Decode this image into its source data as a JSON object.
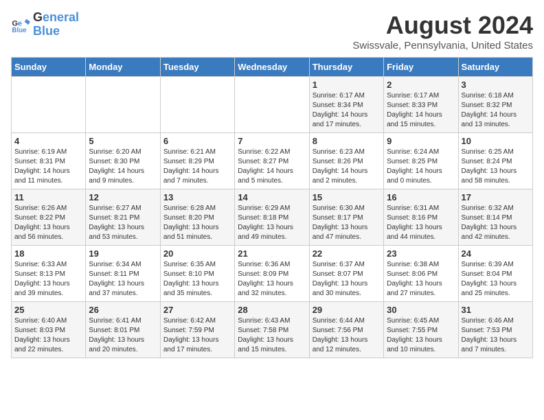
{
  "logo": {
    "line1": "General",
    "line2": "Blue"
  },
  "title": "August 2024",
  "location": "Swissvale, Pennsylvania, United States",
  "days_of_week": [
    "Sunday",
    "Monday",
    "Tuesday",
    "Wednesday",
    "Thursday",
    "Friday",
    "Saturday"
  ],
  "weeks": [
    [
      {
        "day": "",
        "info": ""
      },
      {
        "day": "",
        "info": ""
      },
      {
        "day": "",
        "info": ""
      },
      {
        "day": "",
        "info": ""
      },
      {
        "day": "1",
        "info": "Sunrise: 6:17 AM\nSunset: 8:34 PM\nDaylight: 14 hours\nand 17 minutes."
      },
      {
        "day": "2",
        "info": "Sunrise: 6:17 AM\nSunset: 8:33 PM\nDaylight: 14 hours\nand 15 minutes."
      },
      {
        "day": "3",
        "info": "Sunrise: 6:18 AM\nSunset: 8:32 PM\nDaylight: 14 hours\nand 13 minutes."
      }
    ],
    [
      {
        "day": "4",
        "info": "Sunrise: 6:19 AM\nSunset: 8:31 PM\nDaylight: 14 hours\nand 11 minutes."
      },
      {
        "day": "5",
        "info": "Sunrise: 6:20 AM\nSunset: 8:30 PM\nDaylight: 14 hours\nand 9 minutes."
      },
      {
        "day": "6",
        "info": "Sunrise: 6:21 AM\nSunset: 8:29 PM\nDaylight: 14 hours\nand 7 minutes."
      },
      {
        "day": "7",
        "info": "Sunrise: 6:22 AM\nSunset: 8:27 PM\nDaylight: 14 hours\nand 5 minutes."
      },
      {
        "day": "8",
        "info": "Sunrise: 6:23 AM\nSunset: 8:26 PM\nDaylight: 14 hours\nand 2 minutes."
      },
      {
        "day": "9",
        "info": "Sunrise: 6:24 AM\nSunset: 8:25 PM\nDaylight: 14 hours\nand 0 minutes."
      },
      {
        "day": "10",
        "info": "Sunrise: 6:25 AM\nSunset: 8:24 PM\nDaylight: 13 hours\nand 58 minutes."
      }
    ],
    [
      {
        "day": "11",
        "info": "Sunrise: 6:26 AM\nSunset: 8:22 PM\nDaylight: 13 hours\nand 56 minutes."
      },
      {
        "day": "12",
        "info": "Sunrise: 6:27 AM\nSunset: 8:21 PM\nDaylight: 13 hours\nand 53 minutes."
      },
      {
        "day": "13",
        "info": "Sunrise: 6:28 AM\nSunset: 8:20 PM\nDaylight: 13 hours\nand 51 minutes."
      },
      {
        "day": "14",
        "info": "Sunrise: 6:29 AM\nSunset: 8:18 PM\nDaylight: 13 hours\nand 49 minutes."
      },
      {
        "day": "15",
        "info": "Sunrise: 6:30 AM\nSunset: 8:17 PM\nDaylight: 13 hours\nand 47 minutes."
      },
      {
        "day": "16",
        "info": "Sunrise: 6:31 AM\nSunset: 8:16 PM\nDaylight: 13 hours\nand 44 minutes."
      },
      {
        "day": "17",
        "info": "Sunrise: 6:32 AM\nSunset: 8:14 PM\nDaylight: 13 hours\nand 42 minutes."
      }
    ],
    [
      {
        "day": "18",
        "info": "Sunrise: 6:33 AM\nSunset: 8:13 PM\nDaylight: 13 hours\nand 39 minutes."
      },
      {
        "day": "19",
        "info": "Sunrise: 6:34 AM\nSunset: 8:11 PM\nDaylight: 13 hours\nand 37 minutes."
      },
      {
        "day": "20",
        "info": "Sunrise: 6:35 AM\nSunset: 8:10 PM\nDaylight: 13 hours\nand 35 minutes."
      },
      {
        "day": "21",
        "info": "Sunrise: 6:36 AM\nSunset: 8:09 PM\nDaylight: 13 hours\nand 32 minutes."
      },
      {
        "day": "22",
        "info": "Sunrise: 6:37 AM\nSunset: 8:07 PM\nDaylight: 13 hours\nand 30 minutes."
      },
      {
        "day": "23",
        "info": "Sunrise: 6:38 AM\nSunset: 8:06 PM\nDaylight: 13 hours\nand 27 minutes."
      },
      {
        "day": "24",
        "info": "Sunrise: 6:39 AM\nSunset: 8:04 PM\nDaylight: 13 hours\nand 25 minutes."
      }
    ],
    [
      {
        "day": "25",
        "info": "Sunrise: 6:40 AM\nSunset: 8:03 PM\nDaylight: 13 hours\nand 22 minutes."
      },
      {
        "day": "26",
        "info": "Sunrise: 6:41 AM\nSunset: 8:01 PM\nDaylight: 13 hours\nand 20 minutes."
      },
      {
        "day": "27",
        "info": "Sunrise: 6:42 AM\nSunset: 7:59 PM\nDaylight: 13 hours\nand 17 minutes."
      },
      {
        "day": "28",
        "info": "Sunrise: 6:43 AM\nSunset: 7:58 PM\nDaylight: 13 hours\nand 15 minutes."
      },
      {
        "day": "29",
        "info": "Sunrise: 6:44 AM\nSunset: 7:56 PM\nDaylight: 13 hours\nand 12 minutes."
      },
      {
        "day": "30",
        "info": "Sunrise: 6:45 AM\nSunset: 7:55 PM\nDaylight: 13 hours\nand 10 minutes."
      },
      {
        "day": "31",
        "info": "Sunrise: 6:46 AM\nSunset: 7:53 PM\nDaylight: 13 hours\nand 7 minutes."
      }
    ]
  ]
}
